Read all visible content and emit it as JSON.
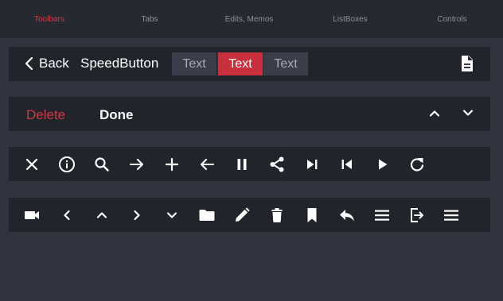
{
  "tabs": [
    {
      "label": "Toolbars",
      "active": true
    },
    {
      "label": "Tabs",
      "active": false
    },
    {
      "label": "Edits, Memos",
      "active": false
    },
    {
      "label": "ListBoxes",
      "active": false
    },
    {
      "label": "Controls",
      "active": false
    }
  ],
  "toolbar1": {
    "back_label": "Back",
    "speed_button_label": "SpeedButton",
    "segments": [
      {
        "label": "Text",
        "selected": false
      },
      {
        "label": "Text",
        "selected": true
      },
      {
        "label": "Text",
        "selected": false
      }
    ],
    "document_icon": "document-icon"
  },
  "toolbar2": {
    "delete_label": "Delete",
    "done_label": "Done",
    "icons": [
      "chevron-up-icon",
      "chevron-down-icon"
    ]
  },
  "toolbar3": {
    "icons": [
      "close-icon",
      "info-icon",
      "search-icon",
      "arrow-right-icon",
      "plus-icon",
      "arrow-left-icon",
      "pause-icon",
      "share-icon",
      "skip-next-icon",
      "skip-previous-icon",
      "play-icon",
      "refresh-icon"
    ]
  },
  "toolbar4": {
    "icons": [
      "video-camera-icon",
      "chevron-left-icon",
      "chevron-up-icon",
      "chevron-right-icon",
      "chevron-down-icon",
      "folder-icon",
      "pencil-icon",
      "trash-icon",
      "bookmark-icon",
      "reply-icon",
      "menu-icon",
      "exit-icon",
      "menu-icon"
    ]
  },
  "colors": {
    "accent": "#c7303c",
    "background": "#31333f",
    "toolbar": "#22242c",
    "topbar": "#272931"
  }
}
